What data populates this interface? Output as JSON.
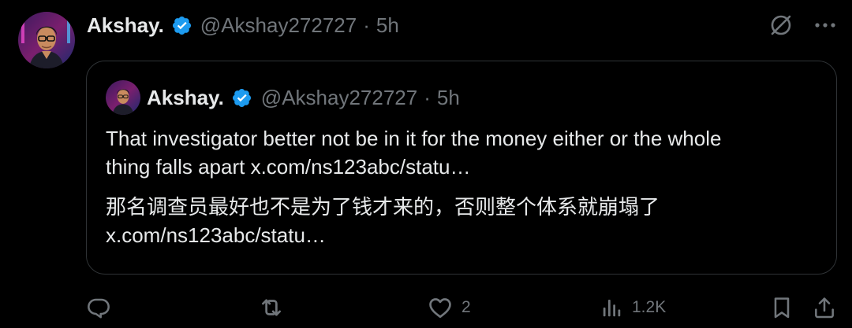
{
  "tweet": {
    "author_name": "Akshay.",
    "handle": "@Akshay272727",
    "separator": "·",
    "time": "5h"
  },
  "quoted_tweet": {
    "author_name": "Akshay.",
    "handle": "@Akshay272727",
    "separator": "·",
    "time": "5h",
    "text_line1": "That investigator better not be in it for the money either or the whole",
    "text_line2_prefix": "thing falls apart ",
    "link_1": "x.com/ns123abc/statu…",
    "translated_text": "那名调查员最好也不是为了钱才来的，否则整个体系就崩塌了",
    "link_2": "x.com/ns123abc/statu…"
  },
  "actions": {
    "reply_count": "",
    "retweet_count": "",
    "like_count": "2",
    "views_count": "1.2K"
  },
  "icons": {
    "verified": "verified-badge-icon",
    "grok": "grok-icon",
    "more": "more-dots-icon",
    "reply": "reply-icon",
    "retweet": "retweet-icon",
    "like": "heart-icon",
    "views": "views-icon",
    "bookmark": "bookmark-icon",
    "share": "share-icon"
  },
  "colors": {
    "background": "#000000",
    "text_primary": "#e7e9ea",
    "text_secondary": "#71767b",
    "border": "#2f3336",
    "verified_blue": "#1d9bf0"
  }
}
